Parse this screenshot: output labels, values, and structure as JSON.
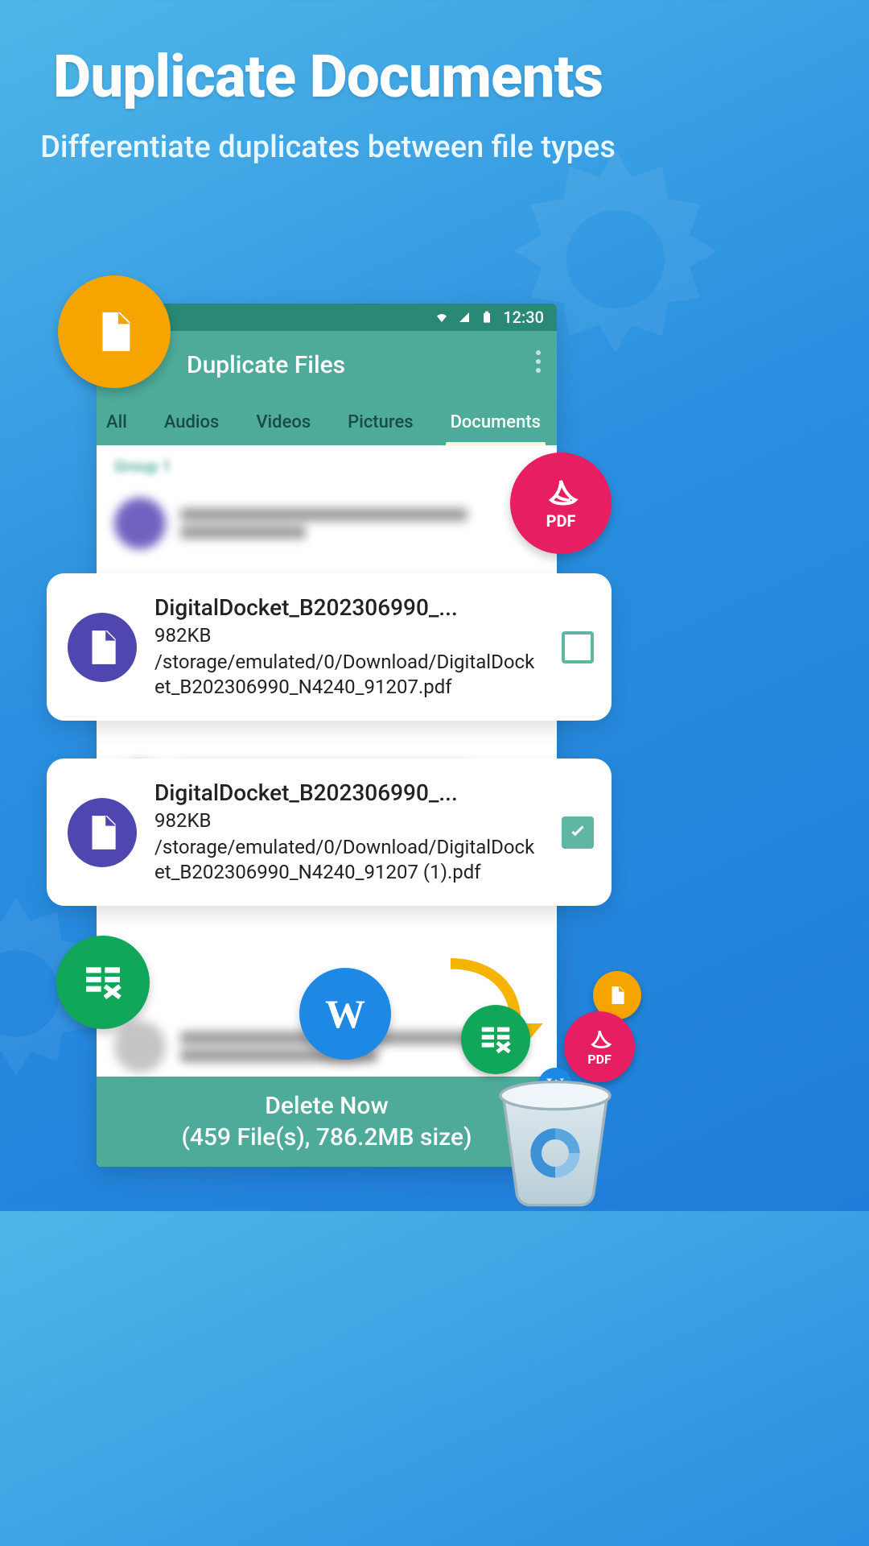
{
  "hero": {
    "title": "Duplicate Documents",
    "subtitle": "Differentiate duplicates between file types"
  },
  "statusbar": {
    "time": "12:30"
  },
  "appbar": {
    "title": "Duplicate Files"
  },
  "tabs": [
    "All",
    "Audios",
    "Videos",
    "Pictures",
    "Documents"
  ],
  "active_tab_index": 4,
  "group_label": "Group 1",
  "files": [
    {
      "name": "DigitalDocket_B202306990_...",
      "size": "982KB",
      "path": "/storage/emulated/0/Download/DigitalDocket_B202306990_N4240_91207.pdf",
      "checked": false
    },
    {
      "name": "DigitalDocket_B202306990_...",
      "size": "982KB",
      "path": "/storage/emulated/0/Download/DigitalDocket_B202306990_N4240_91207 (1).pdf",
      "checked": true
    }
  ],
  "delete_bar": {
    "line1": "Delete Now",
    "line2": "(459 File(s), 786.2MB size)"
  },
  "icons": {
    "doc": "file-doc",
    "pdf": "PDF",
    "sheet": "spreadsheet",
    "word": "W"
  },
  "colors": {
    "accent": "#4eab99",
    "accent_dark": "#2a8876",
    "orange": "#f5a400",
    "pink": "#e81e63",
    "green": "#10a75a",
    "blue": "#1e88e5",
    "indigo": "#5046af"
  }
}
